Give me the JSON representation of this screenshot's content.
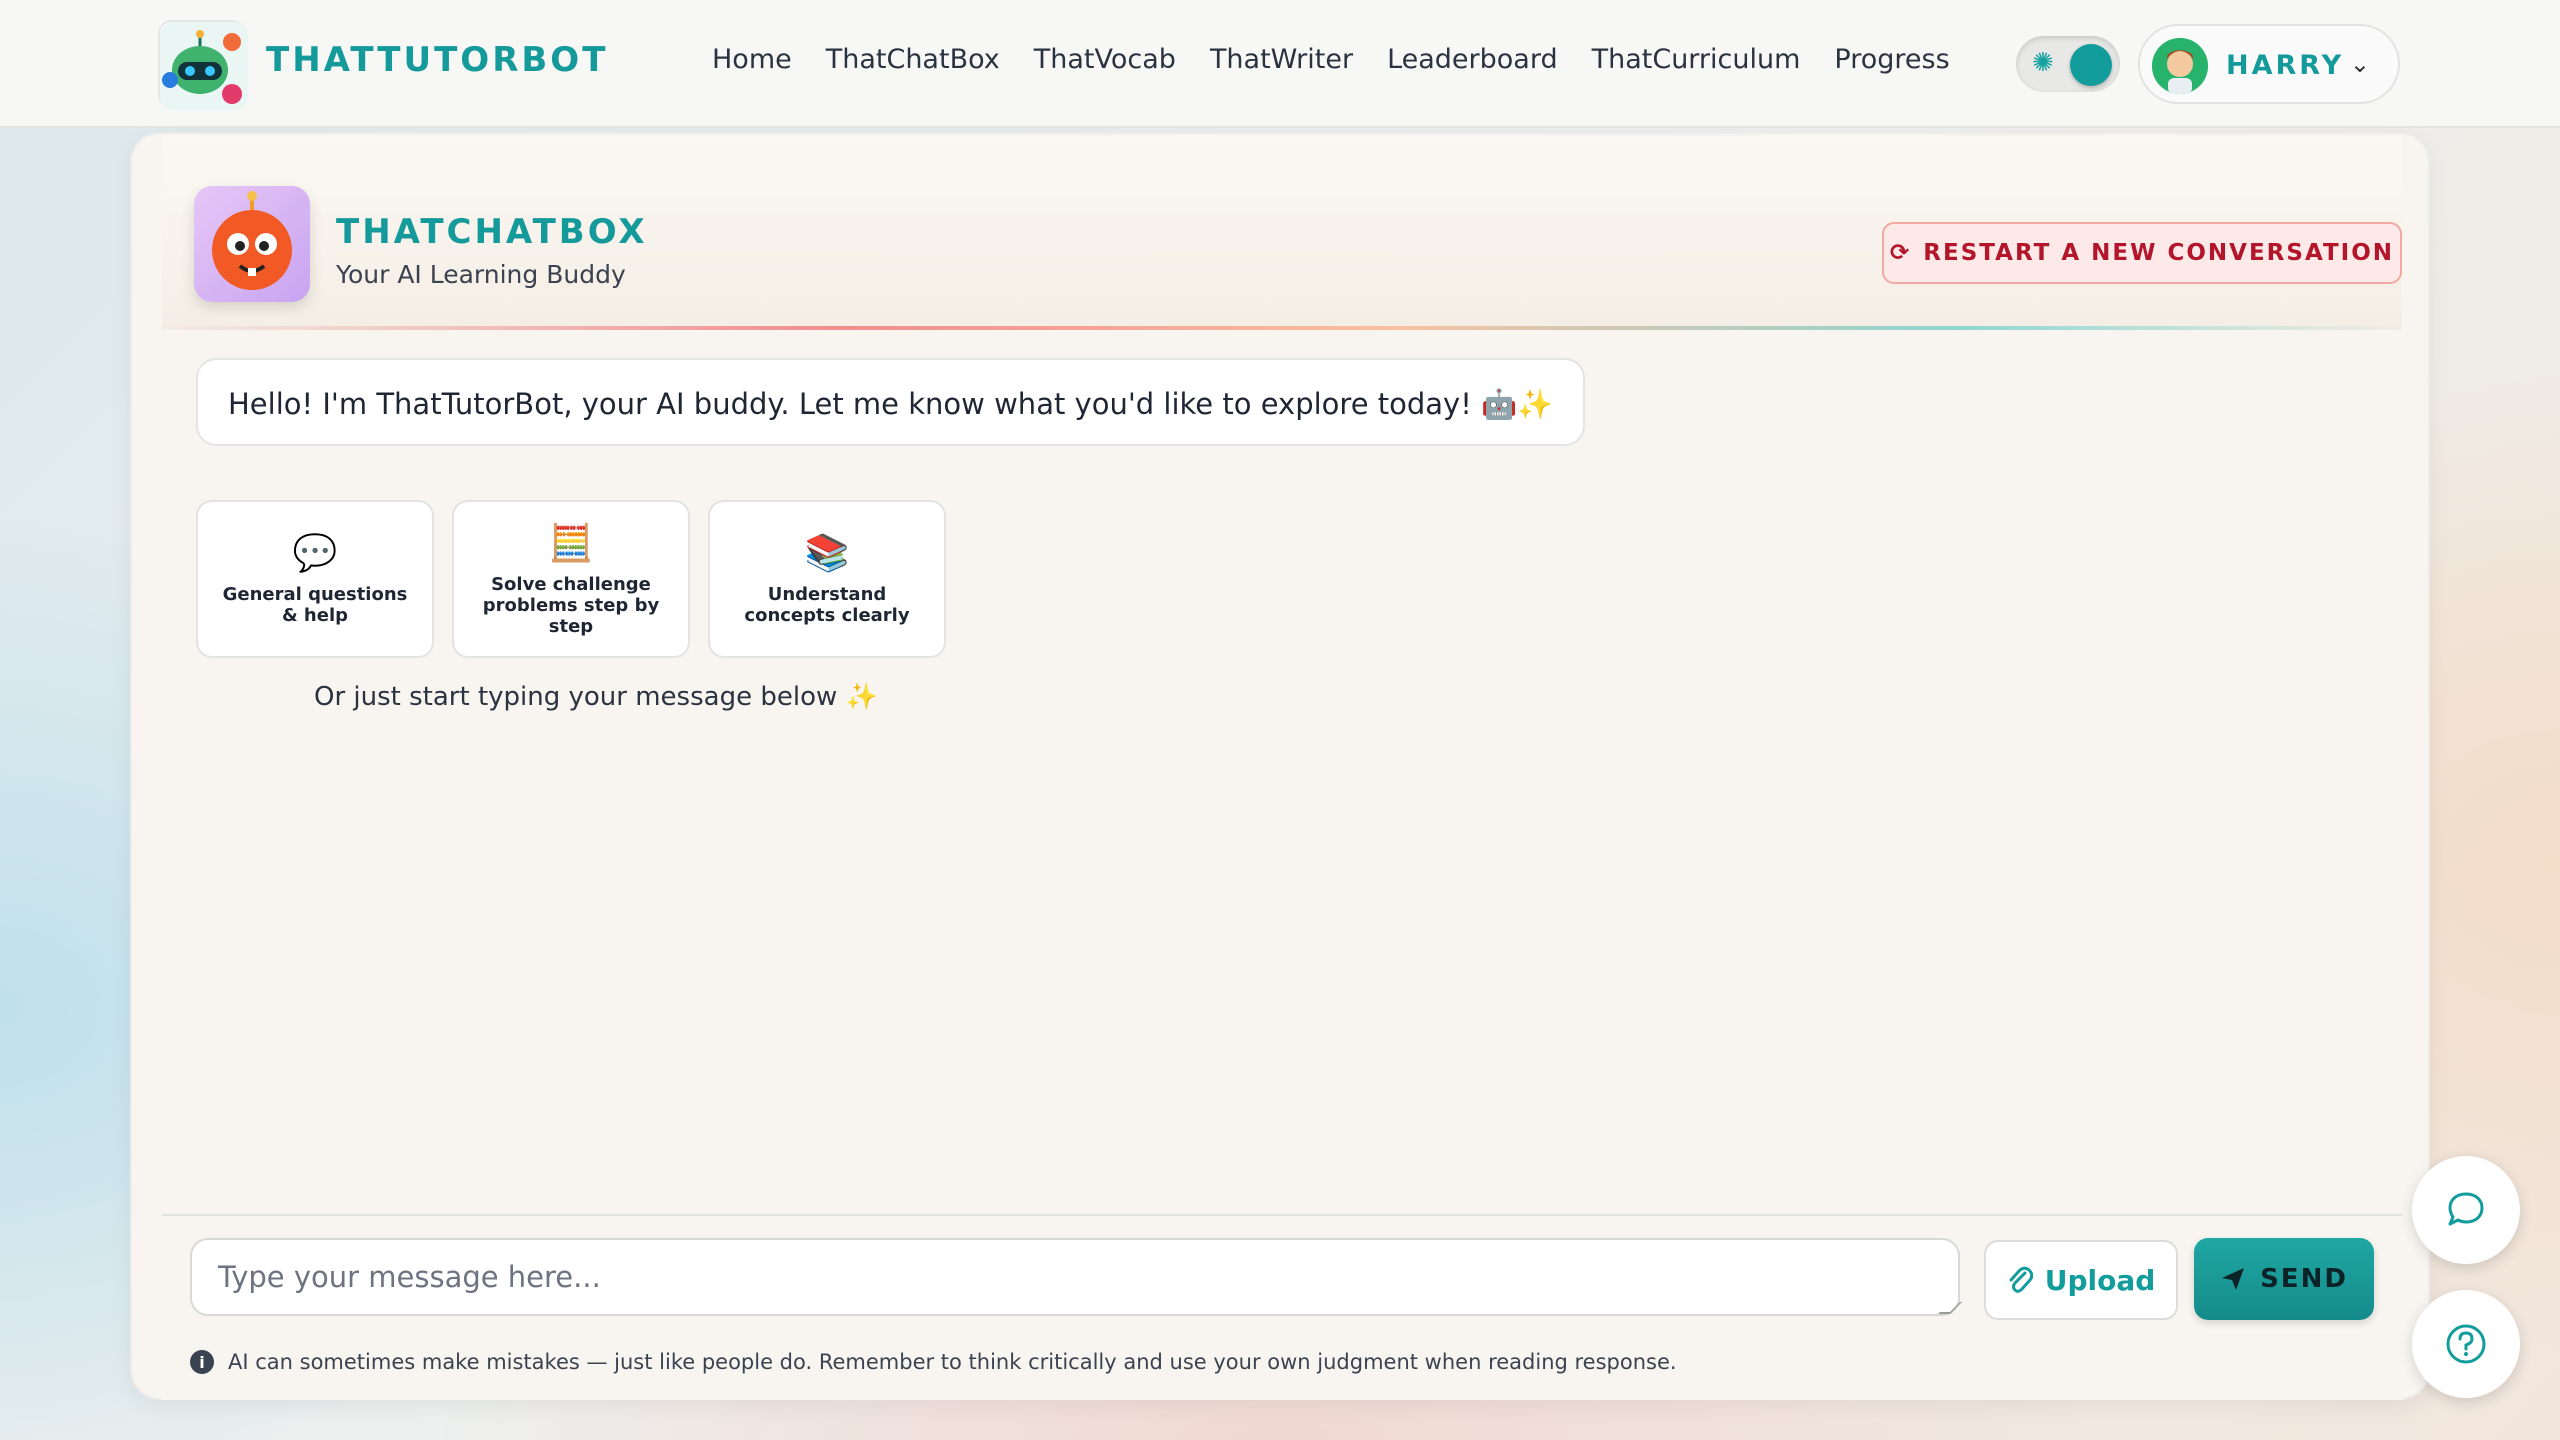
{
  "brand": {
    "title": "THATTUTORBOT"
  },
  "nav": {
    "items": [
      "Home",
      "ThatChatBox",
      "ThatVocab",
      "ThatWriter",
      "Leaderboard",
      "ThatCurriculum",
      "Progress"
    ]
  },
  "user": {
    "name": "HARRY"
  },
  "chatbox": {
    "title": "THATCHATBOX",
    "subtitle": "Your AI Learning Buddy",
    "restart_label": "RESTART A NEW CONVERSATION"
  },
  "chat": {
    "greeting": "Hello! I'm ThatTutorBot, your AI buddy. Let me know what you'd like to explore today! 🤖✨",
    "tiles": [
      {
        "icon": "💬",
        "label": "General questions & help"
      },
      {
        "icon": "🧮",
        "label": "Solve challenge problems step by step"
      },
      {
        "icon": "📚",
        "label": "Understand concepts clearly"
      }
    ],
    "hint": "Or just start typing your message below ✨"
  },
  "composer": {
    "placeholder": "Type your message here...",
    "upload_label": "Upload",
    "send_label": "SEND",
    "disclaimer": "AI can sometimes make mistakes — just like people do. Remember to think critically and use your own judgment when reading response."
  },
  "colors": {
    "accent": "#149a9a",
    "restart": "#b3162b"
  }
}
